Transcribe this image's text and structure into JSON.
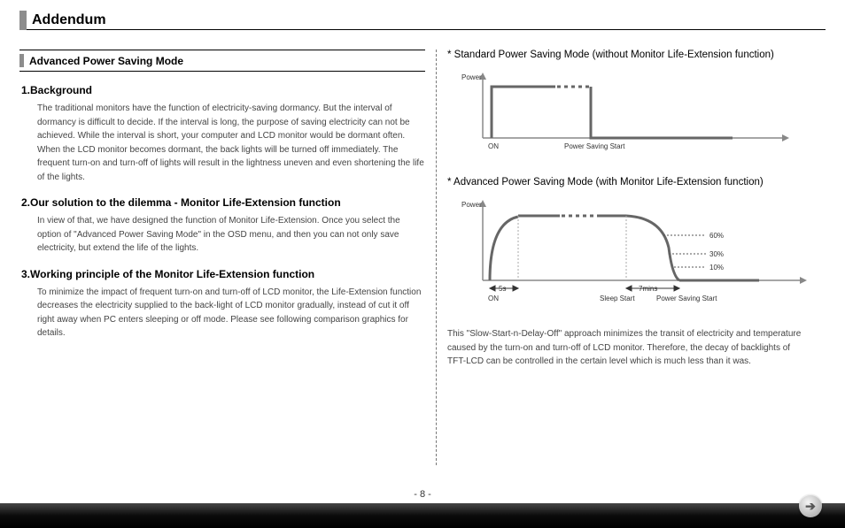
{
  "title": "Addendum",
  "left": {
    "section_header": "Advanced Power Saving Mode",
    "h1": "1.Background",
    "p1": "The traditional monitors have the function of electricity-saving dormancy. But the interval of dormancy is difficult to decide. If the interval is long, the purpose of saving electricity can not be achieved. While the interval is short, your computer and LCD monitor would be dormant often. When the LCD monitor becomes dormant, the back lights will be turned off immediately. The frequent turn-on and turn-off of lights will result in the lightness uneven and even shortening the life of the lights.",
    "h2": "2.Our solution to the dilemma - Monitor Life-Extension function",
    "p2": "In view of that, we have designed the function of Monitor Life-Extension. Once you select the option of  \"Advanced Power Saving Mode\" in the OSD menu, and then you can not only save electricity, but extend the life of the lights.",
    "h3": "3.Working principle of the Monitor Life-Extension function",
    "p3": "To minimize the impact of frequent turn-on and turn-off of LCD monitor, the Life-Extension function decreases the electricity supplied to the back-light of LCD monitor gradually, instead of cut it off right away when PC enters sleeping or off mode. Please see following comparison graphics for details."
  },
  "right": {
    "head1": "* Standard Power Saving Mode (without Monitor Life-Extension function)",
    "head2": "* Advanced Power Saving Mode (with Monitor Life-Extension function)",
    "footer": "This \"Slow-Start-n-Delay-Off\" approach minimizes the transit of electricity and temperature caused by the turn-on and turn-off of LCD monitor. Therefore, the decay of backlights of TFT-LCD can be controlled in the certain level which is much less than it was."
  },
  "chart_data": [
    {
      "type": "line",
      "title": "Standard Power Saving Mode",
      "ylabel": "Power",
      "x_events": [
        "ON",
        "Power Saving Start"
      ],
      "series": [
        {
          "name": "Power",
          "points": [
            {
              "t": 0,
              "p": 0
            },
            {
              "t": 0,
              "p": 100
            },
            {
              "t": 50,
              "p": 100
            },
            {
              "t": 50,
              "p": 0
            },
            {
              "t": 100,
              "p": 0
            }
          ]
        }
      ],
      "ylim": [
        0,
        100
      ]
    },
    {
      "type": "line",
      "title": "Advanced Power Saving Mode",
      "ylabel": "Power",
      "x_events": [
        "ON",
        "Sleep Start",
        "Power Saving Start"
      ],
      "annotations": [
        "5s",
        "7mins",
        "60%",
        "30%",
        "10%"
      ],
      "series": [
        {
          "name": "Power",
          "points": [
            {
              "t": 0,
              "p": 0
            },
            {
              "t": 1,
              "p": 30
            },
            {
              "t": 3,
              "p": 80
            },
            {
              "t": 5,
              "p": 100
            },
            {
              "t": 55,
              "p": 100
            },
            {
              "t": 60,
              "p": 90
            },
            {
              "t": 63,
              "p": 60
            },
            {
              "t": 66,
              "p": 30
            },
            {
              "t": 69,
              "p": 10
            },
            {
              "t": 72,
              "p": 0
            },
            {
              "t": 100,
              "p": 0
            }
          ]
        }
      ],
      "ylim": [
        0,
        100
      ]
    }
  ],
  "chart_labels": {
    "c1_ylabel": "Power",
    "c1_on": "ON",
    "c1_ps": "Power Saving Start",
    "c2_ylabel": "Power",
    "c2_on": "ON",
    "c2_sleep": "Sleep Start",
    "c2_ps": "Power Saving Start",
    "c2_5s": "5s",
    "c2_7m": "7mins",
    "c2_60": "60%",
    "c2_30": "30%",
    "c2_10": "10%"
  },
  "page_number": "- 8 -"
}
